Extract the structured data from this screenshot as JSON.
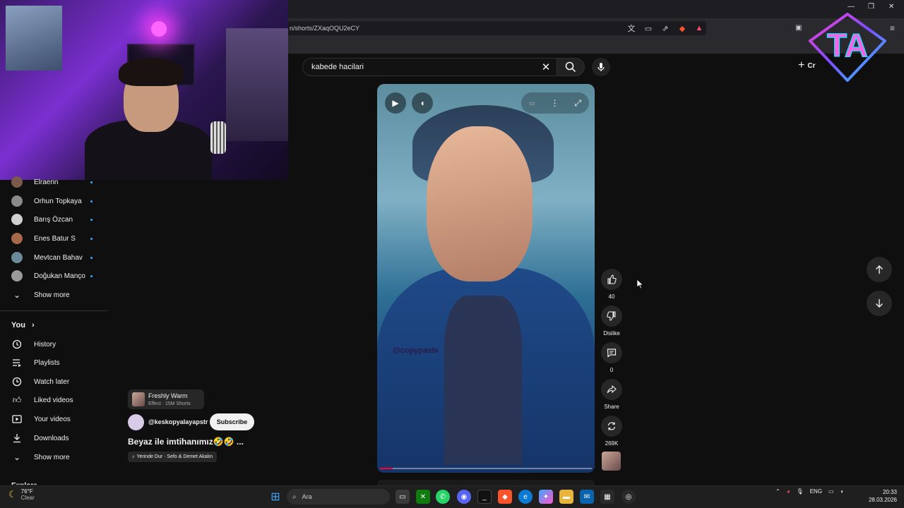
{
  "browser": {
    "url": "n/shorts/ZXaqOQU2eCY",
    "window_controls": [
      "—",
      "❐",
      "✕"
    ]
  },
  "search": {
    "value": "kabede hacilari",
    "create_label": "Cr"
  },
  "sidebar": {
    "subscriptions": [
      {
        "name": "Elraenn",
        "avatar_color": "#7a5a4a"
      },
      {
        "name": "Orhun Topkaya",
        "avatar_color": "#8a8a8a"
      },
      {
        "name": "Barış Özcan",
        "avatar_color": "#d0d0d0"
      },
      {
        "name": "Enes Batur S",
        "avatar_color": "#a66a4a"
      },
      {
        "name": "Mevtcan Bahav",
        "avatar_color": "#6a8a9a"
      },
      {
        "name": "Doğukan Manço",
        "avatar_color": "#9a9a9a"
      }
    ],
    "show_more_1": "Show more",
    "you_label": "You",
    "you_chevron": "›",
    "you_items": [
      {
        "label": "History",
        "icon": "history-icon"
      },
      {
        "label": "Playlists",
        "icon": "playlists-icon"
      },
      {
        "label": "Watch later",
        "icon": "watch-later-icon"
      },
      {
        "label": "Liked videos",
        "icon": "liked-videos-icon"
      },
      {
        "label": "Your videos",
        "icon": "your-videos-icon"
      },
      {
        "label": "Downloads",
        "icon": "downloads-icon"
      }
    ],
    "show_more_2": "Show more",
    "explore_label": "Explore"
  },
  "short": {
    "effect_name": "Freshly Warm",
    "effect_sub": "Effect · 15M Shorts",
    "channel": "@keskopyalayapstr",
    "subscribe_label": "Subscribe",
    "title": "Beyaz ile imtihanımız🤣🤣 ...",
    "music": "Yerinde Dur · Sefo & Demet Akalın",
    "watermark": "@copypaste",
    "progress_fraction": 0.06
  },
  "actions": {
    "likes": "40",
    "dislike_label": "Dislike",
    "comments": "0",
    "share_label": "Share",
    "remix_count": "269K"
  },
  "taskbar": {
    "temp": "76°F",
    "weather": "Clear",
    "search_placeholder": "Ara",
    "language": "ENG",
    "time": "20:33",
    "date": "28.03.2026"
  },
  "logo_text": "TA",
  "colors": {
    "accent_red": "#ff0033",
    "subscription_dot": "#3ea6ff",
    "background": "#0f0f0f"
  }
}
